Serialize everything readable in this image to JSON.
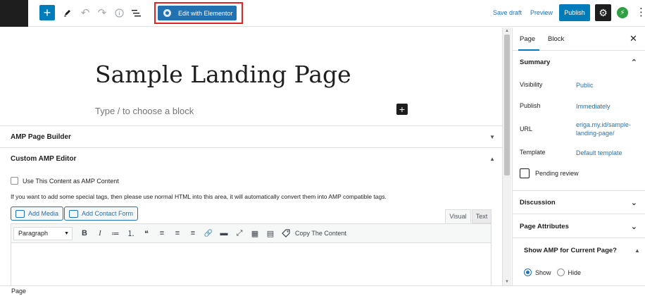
{
  "toolbar": {
    "elementor_label": "Edit with Elementor",
    "save_draft": "Save draft",
    "preview": "Preview",
    "publish": "Publish",
    "icons": [
      "plus-icon",
      "pencil-icon",
      "undo-icon",
      "redo-icon",
      "info-icon",
      "list-view-icon",
      "gear-icon",
      "bolt-icon",
      "more-icon"
    ]
  },
  "editor": {
    "title": "Sample Landing Page",
    "placeholder": "Type / to choose a block",
    "metaboxes": [
      {
        "label": "AMP Page Builder",
        "state": "collapsed"
      },
      {
        "label": "Custom AMP Editor",
        "state": "expanded"
      }
    ],
    "amp_checkbox_label": "Use This Content as AMP Content",
    "amp_note": "If you want to add some special tags, then please use normal HTML into this area, it will automatically convert them into AMP compatible tags.",
    "add_media": "Add Media",
    "add_contact_form": "Add Contact Form",
    "tab_visual": "Visual",
    "tab_text": "Text",
    "format_select": "Paragraph",
    "copy_content": "Copy The Content",
    "mce_buttons": [
      "B",
      "I",
      "≔",
      "⒈",
      "❝",
      "≡",
      "≡",
      "≡",
      "🔗",
      "▬",
      "⤢",
      "▦",
      "▤"
    ]
  },
  "sidebar": {
    "tabs": {
      "page": "Page",
      "block": "Block"
    },
    "summary_title": "Summary",
    "rows": [
      {
        "label": "Visibility",
        "value": "Public"
      },
      {
        "label": "Publish",
        "value": "Immediately"
      },
      {
        "label": "URL",
        "value": "eriga.my.id/sample-landing-page/"
      },
      {
        "label": "Template",
        "value": "Default template"
      }
    ],
    "pending_review": "Pending review",
    "discussion": "Discussion",
    "page_attributes": "Page Attributes",
    "amp_show_title": "Show AMP for Current Page?",
    "amp_show_option": "Show",
    "amp_hide_option": "Hide",
    "amp_selected": "Show"
  },
  "footer": {
    "breadcrumb": "Page"
  },
  "colors": {
    "accent": "#007cba",
    "link": "#2271b1",
    "highlight_frame": "#e02424",
    "dark": "#1e1e1e",
    "bolt": "#2ea043"
  }
}
